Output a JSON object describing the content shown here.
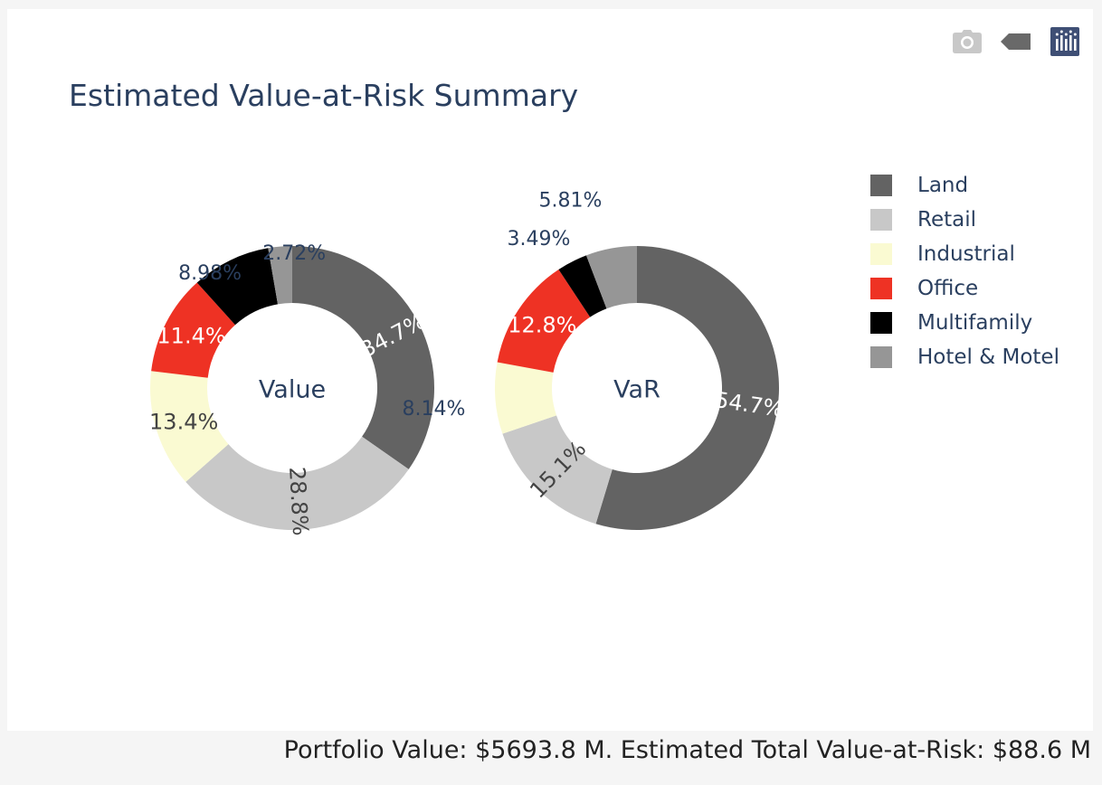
{
  "chart_data": {
    "type": "pie",
    "title": "Estimated Value-at-Risk Summary",
    "categories": [
      "Land",
      "Retail",
      "Industrial",
      "Office",
      "Multifamily",
      "Hotel & Motel"
    ],
    "colors": [
      "#636363",
      "#c8c8c8",
      "#fafad2",
      "#ee3224",
      "#000000",
      "#969696"
    ],
    "series": [
      {
        "name": "Value",
        "hole_label": "Value",
        "values": [
          34.7,
          28.8,
          13.4,
          11.4,
          8.98,
          2.72
        ],
        "value_labels": [
          "34.7%",
          "28.8%",
          "13.4%",
          "11.4%",
          "8.98%",
          "2.72%"
        ]
      },
      {
        "name": "VaR",
        "hole_label": "VaR",
        "values": [
          54.7,
          15.1,
          8.14,
          12.8,
          3.49,
          5.81
        ],
        "value_labels": [
          "54.7%",
          "15.1%",
          "8.14%",
          "12.8%",
          "3.49%",
          "5.81%"
        ]
      }
    ],
    "legend_position": "top-right"
  },
  "legend": {
    "items": [
      {
        "label": "Land",
        "color": "#636363"
      },
      {
        "label": "Retail",
        "color": "#c8c8c8"
      },
      {
        "label": "Industrial",
        "color": "#fafad2"
      },
      {
        "label": "Office",
        "color": "#ee3224"
      },
      {
        "label": "Multifamily",
        "color": "#000000"
      },
      {
        "label": "Hotel & Motel",
        "color": "#969696"
      }
    ]
  },
  "modebar": {
    "icons": [
      "camera-icon",
      "tag-icon",
      "plotly-logo-icon"
    ]
  },
  "footer": {
    "text": "Portfolio Value: $5693.8 M. Estimated Total Value-at-Risk: $88.6 M"
  }
}
